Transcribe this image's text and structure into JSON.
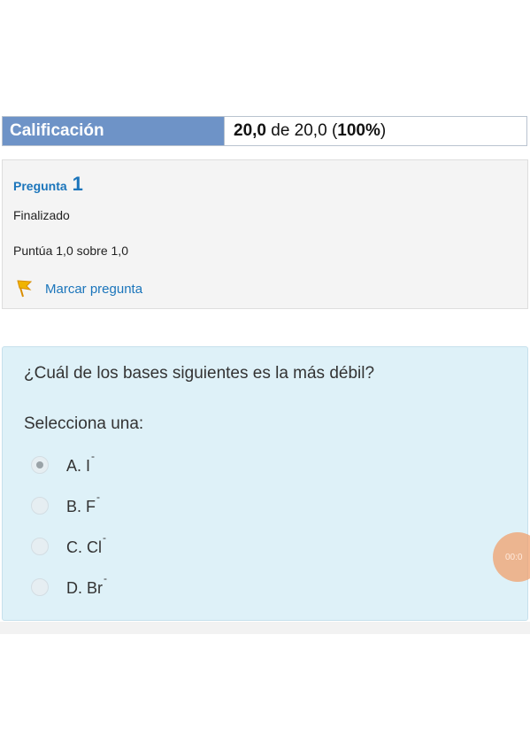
{
  "summary": {
    "label": "Calificación",
    "score": "20,0",
    "of_text": "de 20,0",
    "percent": "100%"
  },
  "question_info": {
    "title": "Pregunta",
    "number": "1",
    "state": "Finalizado",
    "grade": "Puntúa 1,0 sobre 1,0",
    "flag_label": "Marcar pregunta",
    "flag_color": "#f0b400"
  },
  "question": {
    "text": "¿Cuál de los bases siguientes es la más débil?",
    "prompt": "Selecciona una:",
    "selected_index": 0,
    "options": [
      {
        "letter": "A.",
        "symbol": "I",
        "charge": "-"
      },
      {
        "letter": "B.",
        "symbol": "F",
        "charge": "-"
      },
      {
        "letter": "C.",
        "symbol": "Cl",
        "charge": "-"
      },
      {
        "letter": "D.",
        "symbol": "Br",
        "charge": "-"
      }
    ]
  },
  "overlay": {
    "bubble_text": "00:0"
  },
  "colors": {
    "header_bg": "#6e93c7",
    "link": "#1b75bb",
    "question_bg": "#def1f8"
  }
}
